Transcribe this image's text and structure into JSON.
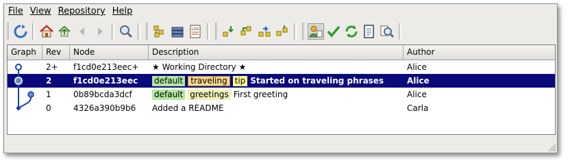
{
  "menu": {
    "items": [
      {
        "label": "File"
      },
      {
        "label": "View"
      },
      {
        "label": "Repository"
      },
      {
        "label": "Help"
      }
    ]
  },
  "toolbar": {
    "icons": [
      "refresh-icon",
      "home-icon",
      "goto-parent-icon",
      "back-icon",
      "forward-icon",
      "search-icon",
      "filter-branch-icon",
      "manifest-icon",
      "log-icon",
      "incoming-icon",
      "pull-icon",
      "outgoing-icon",
      "push-icon",
      "user-icon",
      "commit-check-icon",
      "sync-icon",
      "document-icon",
      "find-icon"
    ]
  },
  "table": {
    "columns": [
      "Graph",
      "Rev",
      "Node",
      "Description",
      "Author"
    ],
    "rows": [
      {
        "rev": "2+",
        "node": "f1cd0e213eec+",
        "tags": [],
        "description": "★ Working Directory ★",
        "author": "Alice",
        "selected": false
      },
      {
        "rev": "2",
        "node": "f1cd0e213eec",
        "tags": [
          {
            "text": "default",
            "kind": "branch-default"
          },
          {
            "text": "traveling",
            "kind": "branch-traveling"
          },
          {
            "text": "tip",
            "kind": "tagname"
          }
        ],
        "description": "Started on traveling phrases",
        "author": "Alice",
        "selected": true
      },
      {
        "rev": "1",
        "node": "0b89bcda3dcf",
        "tags": [
          {
            "text": "default",
            "kind": "branch-default"
          },
          {
            "text": "greetings",
            "kind": "branch-greetings"
          }
        ],
        "description": "First greeting",
        "author": "Alice",
        "selected": false
      },
      {
        "rev": "0",
        "node": "4326a390b9b6",
        "tags": [],
        "description": "Added a README",
        "author": "Carla",
        "selected": false
      }
    ]
  },
  "colors": {
    "selection": "#0a0a7c",
    "graph_line": "#1a3fa8"
  }
}
